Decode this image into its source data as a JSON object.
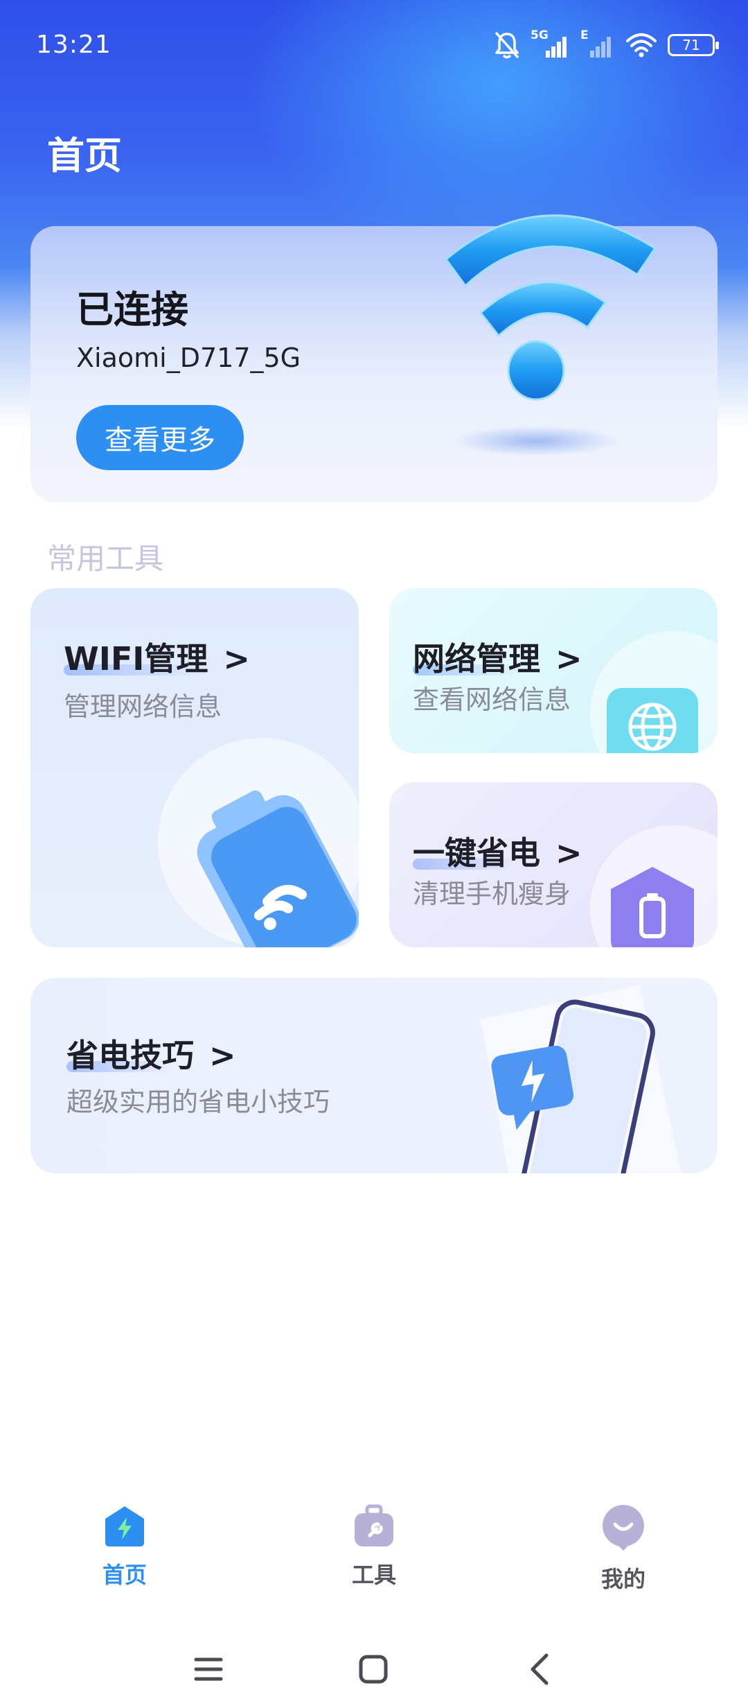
{
  "status_bar": {
    "time": "13:21",
    "network_label": "5G",
    "network2_label": "E",
    "battery_level": "71"
  },
  "header": {
    "title": "首页"
  },
  "connection": {
    "status": "已连接",
    "ssid": "Xiaomi_D717_5G",
    "more_label": "查看更多"
  },
  "tools_section": {
    "title": "常用工具"
  },
  "tools": {
    "wifi": {
      "title": "WIFI管理",
      "subtitle": "管理网络信息"
    },
    "network": {
      "title": "网络管理",
      "subtitle": "查看网络信息"
    },
    "power": {
      "title": "一键省电",
      "subtitle": "清理手机瘦身"
    },
    "tips": {
      "title": "省电技巧",
      "subtitle": "超级实用的省电小技巧"
    }
  },
  "bottom_nav": {
    "items": [
      {
        "label": "首页",
        "icon": "home-bolt-icon",
        "active": true
      },
      {
        "label": "工具",
        "icon": "toolbox-icon",
        "active": false
      },
      {
        "label": "我的",
        "icon": "profile-smile-icon",
        "active": false
      }
    ]
  },
  "colors": {
    "accent": "#2e8ff2",
    "header_blue": "#3a63f0",
    "section_title": "#c5c6dd"
  }
}
